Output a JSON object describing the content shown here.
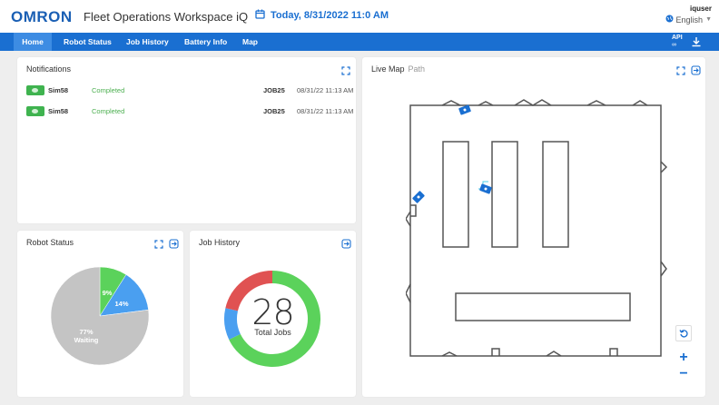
{
  "header": {
    "logo": "OMRON",
    "app_title": "Fleet Operations Workspace iQ",
    "date": "Today, 8/31/2022 11:0 AM",
    "user": "iquser",
    "language": "English"
  },
  "nav": {
    "items": [
      {
        "label": "Home"
      },
      {
        "label": "Robot Status"
      },
      {
        "label": "Job History"
      },
      {
        "label": "Battery Info"
      },
      {
        "label": "Map"
      }
    ],
    "api_label": "API"
  },
  "notifications": {
    "title": "Notifications",
    "rows": [
      {
        "robot": "Sim58",
        "status": "Completed",
        "job": "JOB25",
        "time": "08/31/22 11:13 AM"
      },
      {
        "robot": "Sim58",
        "status": "Completed",
        "job": "JOB25",
        "time": "08/31/22 11:13 AM"
      }
    ]
  },
  "robot_status": {
    "title": "Robot Status",
    "slice_labels": [
      "9%",
      "14%",
      "77%",
      "Waiting"
    ]
  },
  "job_history": {
    "title": "Job History",
    "total": "28",
    "total_label": "Total Jobs"
  },
  "live_map": {
    "title": "Live Map",
    "path_label": "Path"
  },
  "colors": {
    "accent": "#1a6fd1",
    "completed": "#4caf50",
    "waiting": "#c4c4c4",
    "slice_green": "#5bd25b",
    "slice_blue": "#4a9ff0",
    "slice_red": "#e05252"
  },
  "chart_data": [
    {
      "type": "pie",
      "labels": [
        "",
        "",
        "Waiting"
      ],
      "values": [
        9,
        14,
        77
      ],
      "colors": [
        "#5bd25b",
        "#4a9ff0",
        "#c4c4c4"
      ]
    },
    {
      "type": "pie",
      "values": [
        19,
        3,
        6
      ],
      "colors": [
        "#5bd25b",
        "#4a9ff0",
        "#e05252"
      ],
      "center_value": 28,
      "center_label": "Total Jobs"
    }
  ]
}
